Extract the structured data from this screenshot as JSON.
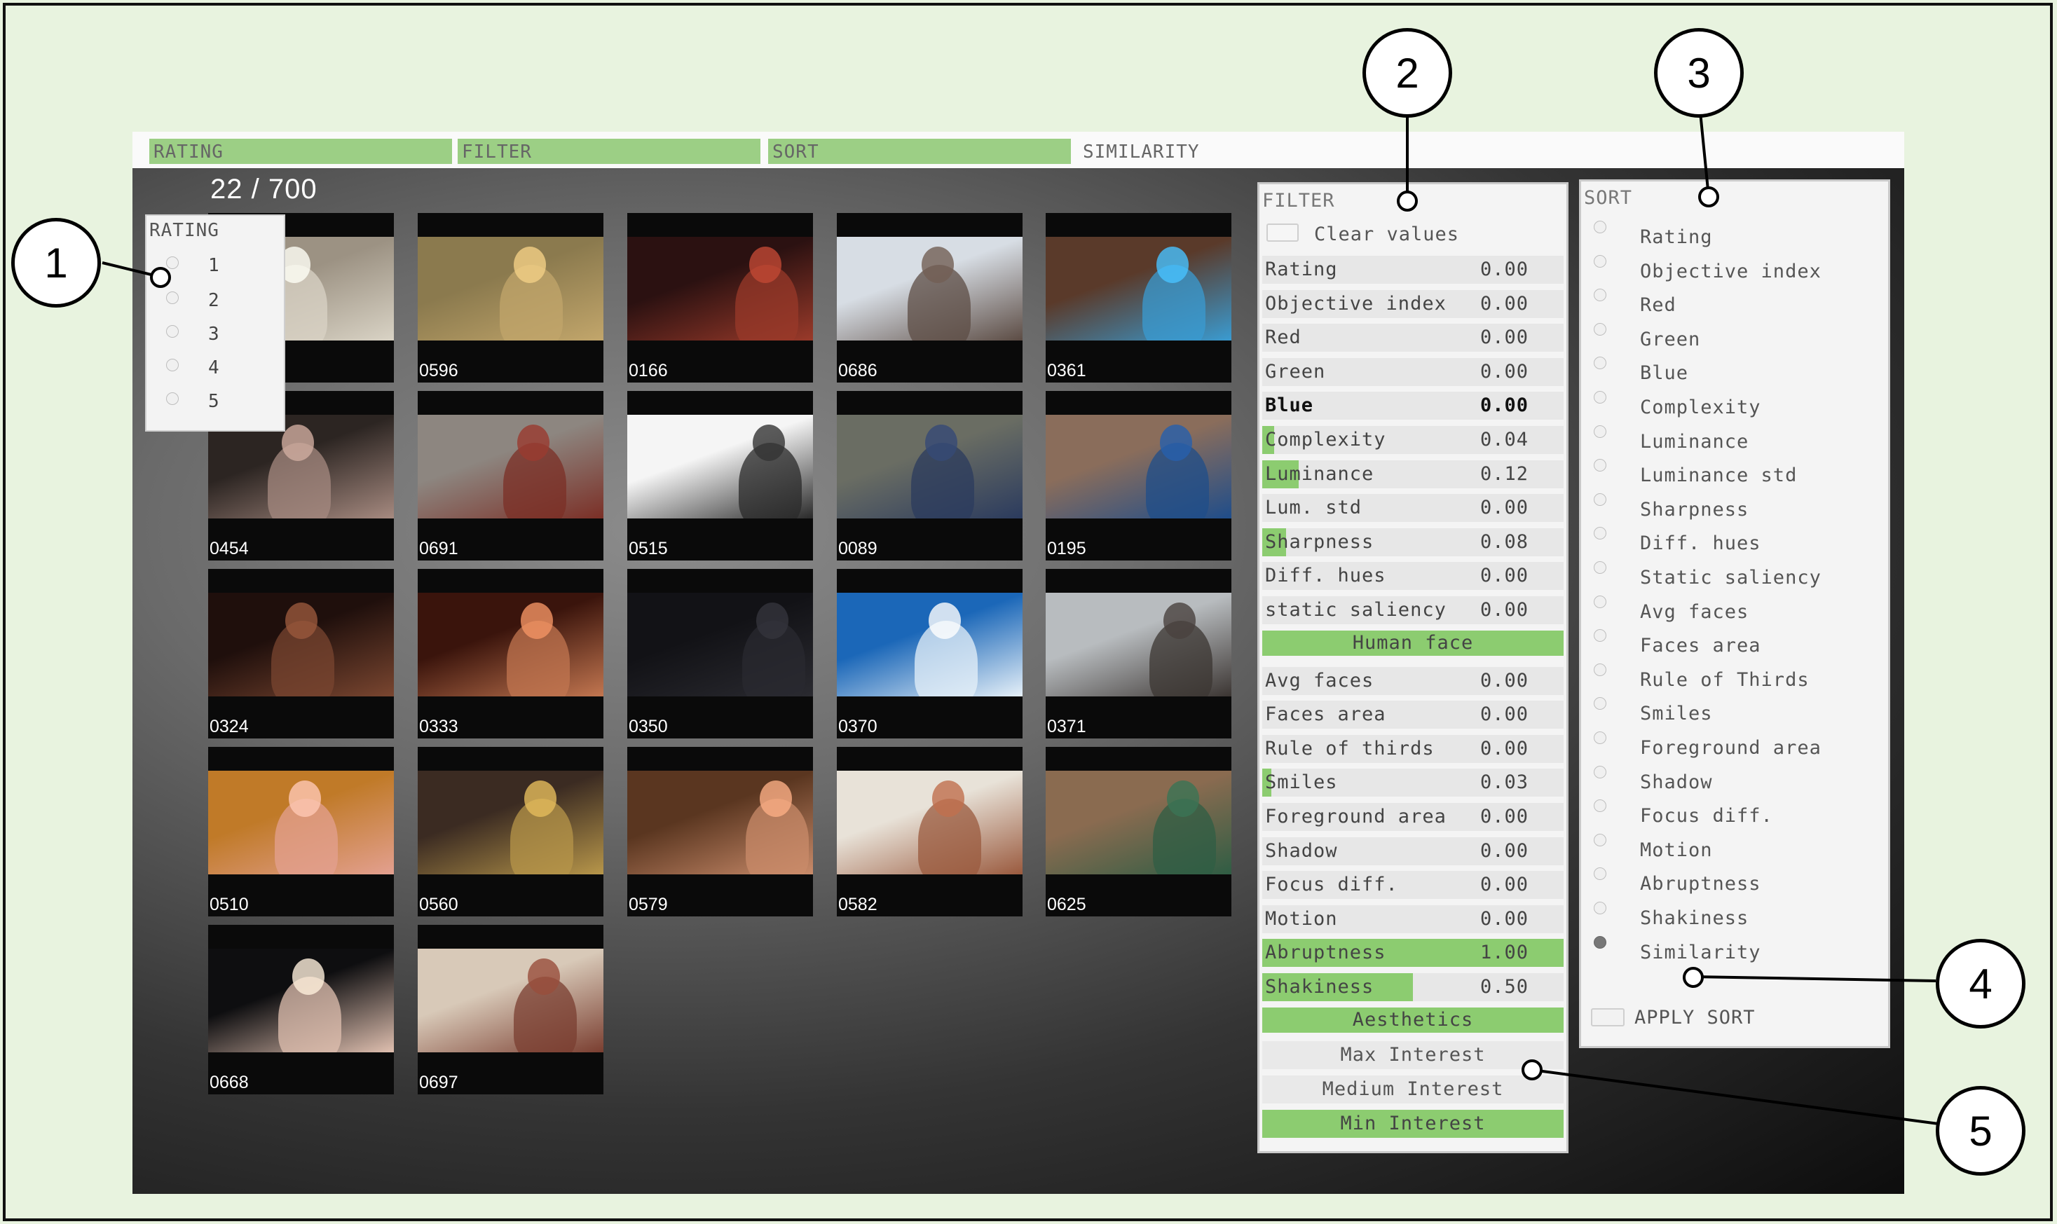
{
  "menu": {
    "tabs": [
      {
        "label": "RATING",
        "active": true
      },
      {
        "label": "FILTER",
        "active": true
      },
      {
        "label": "SORT",
        "active": true
      },
      {
        "label": "SIMILARITY",
        "active": false
      }
    ]
  },
  "counter": "22 / 700",
  "grid": {
    "tiles": [
      {
        "id": "",
        "colors": [
          "#9c9283",
          "#d9d3c5"
        ]
      },
      {
        "id": "0596",
        "colors": [
          "#8b7a4e",
          "#c2a66b"
        ]
      },
      {
        "id": "0166",
        "colors": [
          "#2b1111",
          "#9a3a2a"
        ]
      },
      {
        "id": "0686",
        "colors": [
          "#d7dde4",
          "#5c4c44"
        ]
      },
      {
        "id": "0361",
        "colors": [
          "#5a3a2a",
          "#3a9bd1"
        ]
      },
      {
        "id": "0454",
        "colors": [
          "#2c2522",
          "#a68a80"
        ]
      },
      {
        "id": "0691",
        "colors": [
          "#8d8680",
          "#7b2f26"
        ]
      },
      {
        "id": "0515",
        "colors": [
          "#f5f5f5",
          "#2a2a2a"
        ]
      },
      {
        "id": "0089",
        "colors": [
          "#6a6d63",
          "#2b3b5e"
        ]
      },
      {
        "id": "0195",
        "colors": [
          "#8a6d5b",
          "#1f4d8a"
        ]
      },
      {
        "id": "0324",
        "colors": [
          "#1f0f0c",
          "#7a4630"
        ]
      },
      {
        "id": "0333",
        "colors": [
          "#3a140c",
          "#c27650"
        ]
      },
      {
        "id": "0350",
        "colors": [
          "#121216",
          "#2a2a30"
        ]
      },
      {
        "id": "0370",
        "colors": [
          "#1b67b8",
          "#e6f0f8"
        ]
      },
      {
        "id": "0371",
        "colors": [
          "#b8bcbf",
          "#3b3532"
        ]
      },
      {
        "id": "0510",
        "colors": [
          "#c07a28",
          "#e3a090"
        ]
      },
      {
        "id": "0560",
        "colors": [
          "#3b2b22",
          "#b7964a"
        ]
      },
      {
        "id": "0579",
        "colors": [
          "#5a3620",
          "#c98b6a"
        ]
      },
      {
        "id": "0582",
        "colors": [
          "#e8e2d8",
          "#9a5a3e"
        ]
      },
      {
        "id": "0625",
        "colors": [
          "#8a6b50",
          "#2f5d44"
        ]
      },
      {
        "id": "0668",
        "colors": [
          "#0e0e10",
          "#e0c0b0"
        ]
      },
      {
        "id": "0697",
        "colors": [
          "#d8c9b8",
          "#7a3e30"
        ]
      }
    ]
  },
  "rating": {
    "title": "RATING",
    "options": [
      "1",
      "2",
      "3",
      "4",
      "5"
    ]
  },
  "filter": {
    "title": "FILTER",
    "clear_label": "Clear values",
    "rows": [
      {
        "label": "Rating",
        "value": "0.00"
      },
      {
        "label": "Objective index",
        "value": "0.00"
      },
      {
        "label": "Red",
        "value": "0.00"
      },
      {
        "label": "Green",
        "value": "0.00"
      },
      {
        "label": "Blue",
        "value": "0.00"
      },
      {
        "label": "Complexity",
        "value": "0.04"
      },
      {
        "label": "Luminance",
        "value": "0.12"
      },
      {
        "label": "Lum. std",
        "value": "0.00"
      },
      {
        "label": "Sharpness",
        "value": "0.08"
      },
      {
        "label": "Diff. hues",
        "value": "0.00"
      },
      {
        "label": "static saliency",
        "value": "0.00"
      }
    ],
    "section_human_face": "Human face",
    "rows_face": [
      {
        "label": "Avg faces",
        "value": "0.00"
      },
      {
        "label": "Faces area",
        "value": "0.00"
      },
      {
        "label": "Rule of thirds",
        "value": "0.00"
      },
      {
        "label": "Smiles",
        "value": "0.03"
      },
      {
        "label": "Foreground area",
        "value": "0.00"
      },
      {
        "label": "Shadow",
        "value": "0.00"
      },
      {
        "label": "Focus diff.",
        "value": "0.00"
      },
      {
        "label": "Motion",
        "value": "0.00"
      },
      {
        "label": "Abruptness",
        "value": "1.00"
      },
      {
        "label": "Shakiness",
        "value": "0.50"
      }
    ],
    "section_aesthetics": "Aesthetics",
    "interest_buttons": [
      {
        "label": "Max Interest",
        "selected": false
      },
      {
        "label": "Medium Interest",
        "selected": false
      },
      {
        "label": "Min Interest",
        "selected": true
      }
    ]
  },
  "sort": {
    "title": "SORT",
    "options": [
      {
        "label": "Rating",
        "selected": false
      },
      {
        "label": "Objective index",
        "selected": false
      },
      {
        "label": "Red",
        "selected": false
      },
      {
        "label": "Green",
        "selected": false
      },
      {
        "label": "Blue",
        "selected": false
      },
      {
        "label": "Complexity",
        "selected": false
      },
      {
        "label": "Luminance",
        "selected": false
      },
      {
        "label": "Luminance std",
        "selected": false
      },
      {
        "label": "Sharpness",
        "selected": false
      },
      {
        "label": "Diff. hues",
        "selected": false
      },
      {
        "label": "Static saliency",
        "selected": false
      },
      {
        "label": "Avg faces",
        "selected": false
      },
      {
        "label": "Faces area",
        "selected": false
      },
      {
        "label": "Rule of Thirds",
        "selected": false
      },
      {
        "label": "Smiles",
        "selected": false
      },
      {
        "label": "Foreground area",
        "selected": false
      },
      {
        "label": "Shadow",
        "selected": false
      },
      {
        "label": "Focus diff.",
        "selected": false
      },
      {
        "label": "Motion",
        "selected": false
      },
      {
        "label": "Abruptness",
        "selected": false
      },
      {
        "label": "Shakiness",
        "selected": false
      },
      {
        "label": "Similarity",
        "selected": true
      }
    ],
    "apply_label": "APPLY SORT"
  },
  "callouts": [
    "1",
    "2",
    "3",
    "4",
    "5"
  ],
  "colors": {
    "accent_green": "#8ccc70",
    "menu_green": "#9ccf85",
    "page_background": "#e8f3df"
  }
}
